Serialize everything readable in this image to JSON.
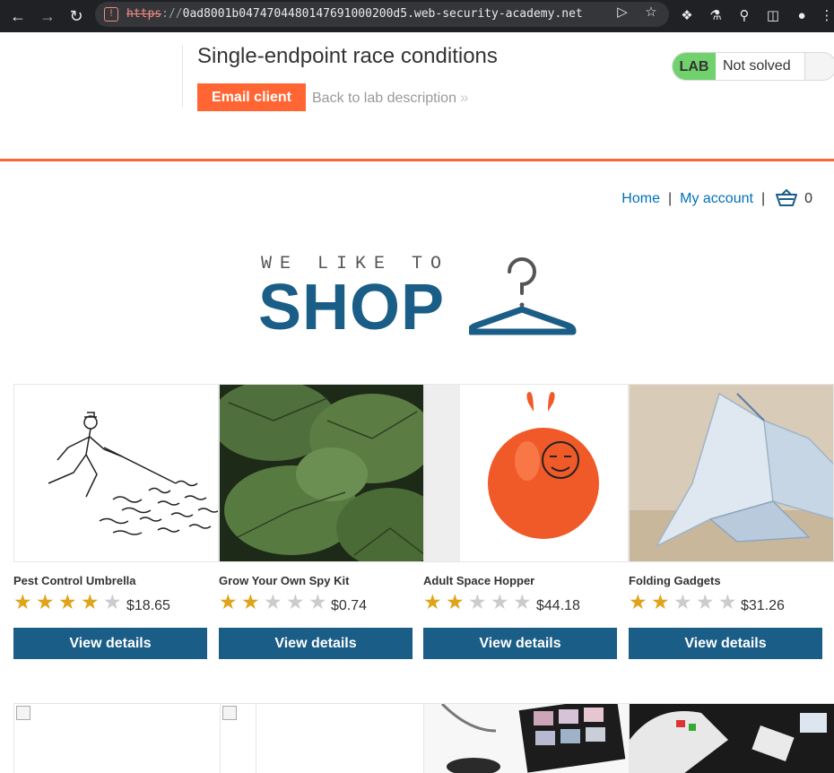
{
  "browser": {
    "url_scheme": "https",
    "url_separator": "://",
    "url_host": "0ad8001b0474704480147691000200d5.web-security-academy.net"
  },
  "lab": {
    "title": "Single-endpoint race conditions",
    "email_client_label": "Email client",
    "back_link_label": "Back to lab description",
    "back_link_chevron": "»",
    "status_badge": "LAB",
    "status_text": "Not solved",
    "accent_color": "#ff6633"
  },
  "nav": {
    "home": "Home",
    "separator": "|",
    "my_account": "My account",
    "cart_count": "0"
  },
  "shop_logo": {
    "tagline": "WE LIKE TO",
    "word": "SHOP"
  },
  "products": [
    {
      "name": "Pest Control Umbrella",
      "rating": 4,
      "price": "$18.65",
      "button": "View details"
    },
    {
      "name": "Grow Your Own Spy Kit",
      "rating": 2,
      "price": "$0.74",
      "button": "View details"
    },
    {
      "name": "Adult Space Hopper",
      "rating": 2,
      "price": "$44.18",
      "button": "View details"
    },
    {
      "name": "Folding Gadgets",
      "rating": 2,
      "price": "$31.26",
      "button": "View details"
    }
  ],
  "icons": {
    "back": "arrow-left-icon",
    "forward": "arrow-right-icon",
    "reload": "reload-icon",
    "insecure": "not-secure-icon",
    "send": "send-tab-icon",
    "bookmark": "star-icon",
    "extensions": "puzzle-icon",
    "lab_ext": "flask-icon",
    "zoom": "search-icon",
    "sidepanel": "side-panel-icon",
    "profile": "profile-icon",
    "menu": "kebab-menu-icon",
    "cart": "cart-icon"
  },
  "colors": {
    "brand_blue": "#1a5d87",
    "link_blue": "#0071bc",
    "star_gold": "#e0a41a",
    "solved_green": "#70d16d"
  }
}
